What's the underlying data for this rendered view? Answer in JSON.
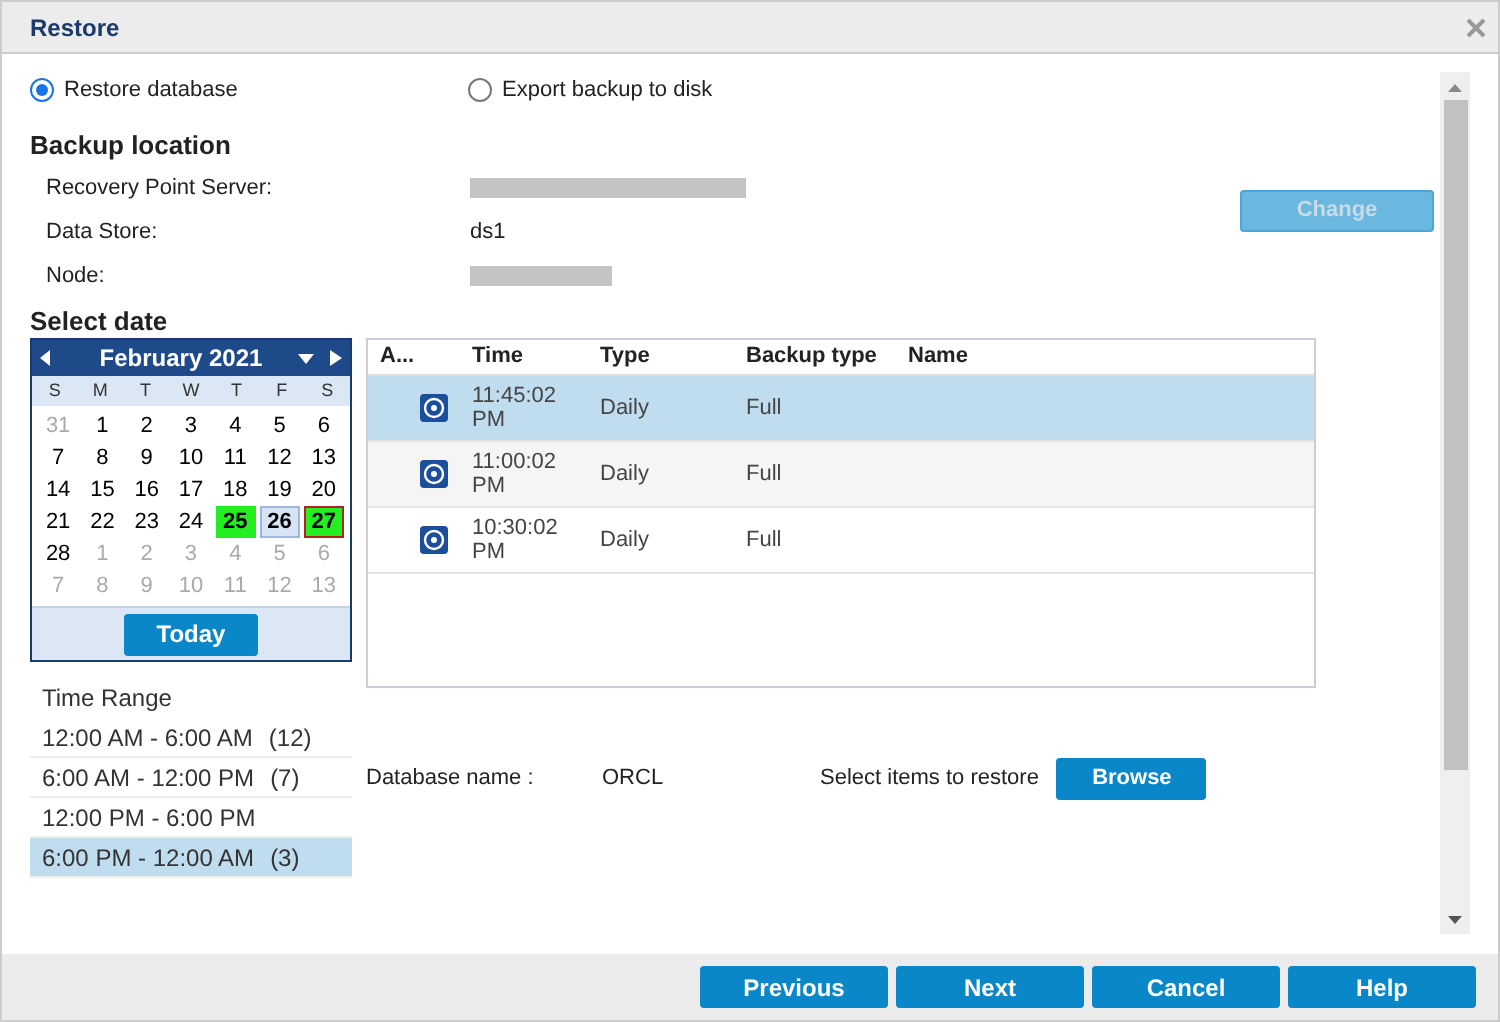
{
  "window": {
    "title": "Restore"
  },
  "mode_options": [
    {
      "label": "Restore database",
      "selected": true
    },
    {
      "label": "Export backup to disk",
      "selected": false
    }
  ],
  "backup_location": {
    "heading": "Backup location",
    "change_button": {
      "label": "Change",
      "disabled": true
    },
    "fields": [
      {
        "label": "Recovery Point Server:",
        "redacted": true
      },
      {
        "label": "Data Store:",
        "value": "ds1",
        "redacted": false
      },
      {
        "label": "Node:",
        "redacted": true
      }
    ]
  },
  "select_date": {
    "heading": "Select date",
    "calendar": {
      "month": "February 2021",
      "weekdays": [
        "S",
        "M",
        "T",
        "W",
        "T",
        "F",
        "S"
      ],
      "days": [
        {
          "day": "31",
          "other_month": true
        },
        {
          "day": "1"
        },
        {
          "day": "2"
        },
        {
          "day": "3"
        },
        {
          "day": "4"
        },
        {
          "day": "5"
        },
        {
          "day": "6"
        },
        {
          "day": "7"
        },
        {
          "day": "8"
        },
        {
          "day": "9"
        },
        {
          "day": "10"
        },
        {
          "day": "11"
        },
        {
          "day": "12"
        },
        {
          "day": "13"
        },
        {
          "day": "14"
        },
        {
          "day": "15"
        },
        {
          "day": "16"
        },
        {
          "day": "17"
        },
        {
          "day": "18"
        },
        {
          "day": "19"
        },
        {
          "day": "20"
        },
        {
          "day": "21"
        },
        {
          "day": "22"
        },
        {
          "day": "23"
        },
        {
          "day": "24"
        },
        {
          "day": "25",
          "has_backup": true
        },
        {
          "day": "26",
          "selected": true
        },
        {
          "day": "27",
          "has_backup": true,
          "today": true
        },
        {
          "day": "28"
        },
        {
          "day": "1",
          "other_month": true
        },
        {
          "day": "2",
          "other_month": true
        },
        {
          "day": "3",
          "other_month": true
        },
        {
          "day": "4",
          "other_month": true
        },
        {
          "day": "5",
          "other_month": true
        },
        {
          "day": "6",
          "other_month": true
        },
        {
          "day": "7",
          "other_month": true
        },
        {
          "day": "8",
          "other_month": true
        },
        {
          "day": "9",
          "other_month": true
        },
        {
          "day": "10",
          "other_month": true
        },
        {
          "day": "11",
          "other_month": true
        },
        {
          "day": "12",
          "other_month": true
        },
        {
          "day": "13",
          "other_month": true
        }
      ],
      "today_button": "Today"
    }
  },
  "time_range": {
    "heading": "Time Range",
    "items": [
      {
        "label": "12:00 AM - 6:00 AM",
        "count": "(12)",
        "selected": false
      },
      {
        "label": "6:00 AM - 12:00 PM",
        "count": "(7)",
        "selected": false
      },
      {
        "label": "12:00 PM - 6:00 PM",
        "selected": false
      },
      {
        "label": "6:00 PM - 12:00 AM",
        "count": "(3)",
        "selected": true
      }
    ]
  },
  "table": {
    "columns": [
      "A...",
      "Time",
      "Type",
      "Backup type",
      "Name"
    ],
    "rows": [
      {
        "time": "11:45:02 PM",
        "type": "Daily",
        "backup_type": "Full",
        "selected": true
      },
      {
        "time": "11:00:02 PM",
        "type": "Daily",
        "backup_type": "Full",
        "selected": false
      },
      {
        "time": "10:30:02 PM",
        "type": "Daily",
        "backup_type": "Full",
        "selected": false
      }
    ]
  },
  "database": {
    "label": "Database name :",
    "value": "ORCL",
    "items_label": "Select items to restore",
    "browse_button": "Browse"
  },
  "footer_buttons": [
    "Previous",
    "Next",
    "Cancel",
    "Help"
  ]
}
